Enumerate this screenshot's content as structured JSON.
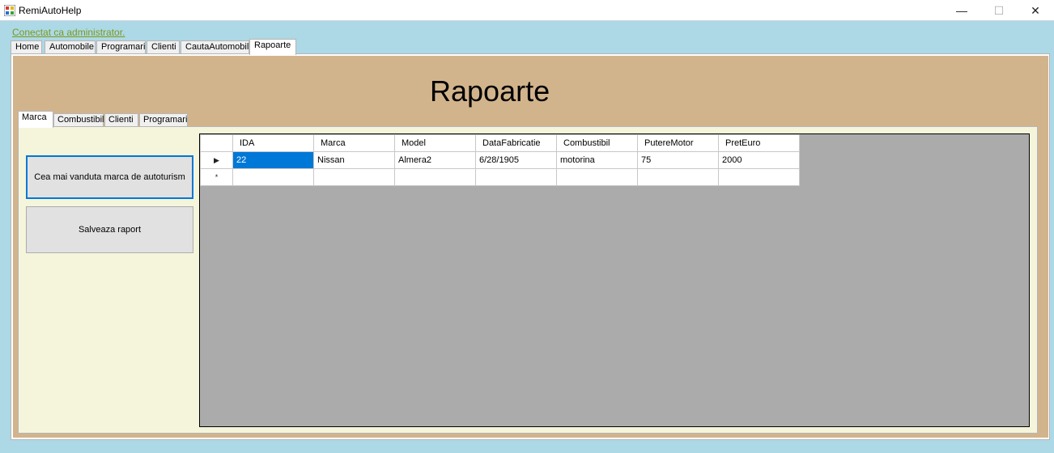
{
  "window": {
    "title": "RemiAutoHelp",
    "minimize_glyph": "—",
    "maximize_glyph": "☐",
    "close_glyph": "✕"
  },
  "admin_link": "Conectat ca administrator.",
  "main_tabs": [
    "Home",
    "Automobile",
    "Programari",
    "Clienti",
    "CautaAutomobil",
    "Rapoarte"
  ],
  "page_title": "Rapoarte",
  "sub_tabs": [
    "Marca",
    "Combustibil",
    "Clienti",
    "Programari"
  ],
  "buttons": {
    "best_brand": "Cea mai vanduta marca de autoturism",
    "save_report": "Salveaza raport"
  },
  "grid": {
    "columns": [
      "IDA",
      "Marca",
      "Model",
      "DataFabricatie",
      "Combustibil",
      "PutereMotor",
      "PretEuro"
    ],
    "rows": [
      [
        "22",
        "Nissan",
        "Almera2",
        "6/28/1905",
        "motorina",
        "75",
        "2000"
      ]
    ],
    "current_row_glyph": "▶",
    "new_row_glyph": "*"
  },
  "colors": {
    "background": "#add8e6",
    "panel": "#d2b48c",
    "subpanel": "#f5f5dc",
    "grid_background": "#ababab",
    "selection": "#0078d7"
  }
}
